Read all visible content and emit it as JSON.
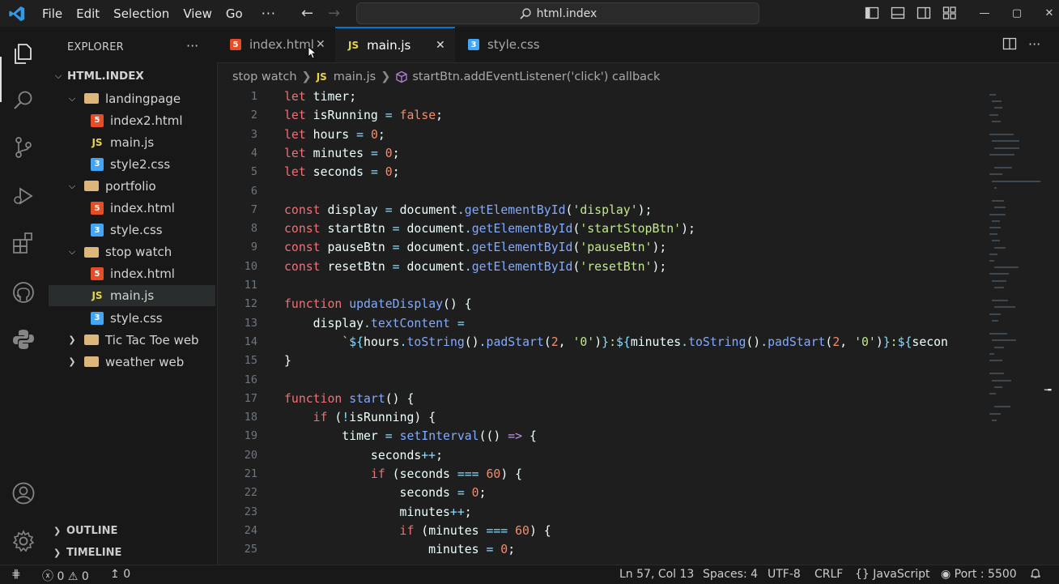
{
  "titlebar": {
    "menu": [
      "File",
      "Edit",
      "Selection",
      "View",
      "Go"
    ],
    "more": "···",
    "search_text": "html.index",
    "window_controls": [
      "—",
      "▢",
      "✕"
    ]
  },
  "sidebar": {
    "header": "EXPLORER",
    "header_more": "···",
    "root": "HTML.INDEX",
    "tree": [
      {
        "label": "landingpage",
        "type": "folder",
        "depth": 1,
        "expanded": true
      },
      {
        "label": "index2.html",
        "type": "html",
        "depth": 2
      },
      {
        "label": "main.js",
        "type": "js",
        "depth": 2
      },
      {
        "label": "style2.css",
        "type": "css",
        "depth": 2
      },
      {
        "label": "portfolio",
        "type": "folder",
        "depth": 1,
        "expanded": true
      },
      {
        "label": "index.html",
        "type": "html",
        "depth": 2
      },
      {
        "label": "style.css",
        "type": "css",
        "depth": 2
      },
      {
        "label": "stop watch",
        "type": "folder",
        "depth": 1,
        "expanded": true
      },
      {
        "label": "index.html",
        "type": "html",
        "depth": 2
      },
      {
        "label": "main.js",
        "type": "js",
        "depth": 2,
        "selected": true
      },
      {
        "label": "style.css",
        "type": "css",
        "depth": 2
      },
      {
        "label": "Tic Tac Toe web",
        "type": "folder",
        "depth": 1,
        "expanded": false
      },
      {
        "label": "weather web",
        "type": "folder",
        "depth": 1,
        "expanded": false
      }
    ],
    "outline": "OUTLINE",
    "timeline": "TIMELINE"
  },
  "tabs": [
    {
      "label": "index.html",
      "type": "html",
      "active": false
    },
    {
      "label": "main.js",
      "type": "js",
      "active": true
    },
    {
      "label": "style.css",
      "type": "css",
      "active": false
    }
  ],
  "breadcrumb": {
    "folder": "stop watch",
    "file": "main.js",
    "symbol": "startBtn.addEventListener('click') callback"
  },
  "editor": {
    "lines": [
      "1",
      "2",
      "3",
      "4",
      "5",
      "6",
      "7",
      "8",
      "9",
      "10",
      "11",
      "12",
      "13",
      "14",
      "15",
      "16",
      "17",
      "18",
      "19",
      "20",
      "21",
      "22",
      "23",
      "24",
      "25"
    ]
  },
  "icons": {
    "js_label": "JS",
    "html_label": "5",
    "css_label": "3"
  },
  "statusbar": {
    "errors": "0",
    "warnings": "0",
    "ports": "0",
    "position": "Ln 57, Col 13",
    "spaces": "Spaces: 4",
    "encoding": "UTF-8",
    "eol": "CRLF",
    "language": "JavaScript",
    "port": "Port : 5500"
  },
  "colors": {
    "accent": "#0078d4",
    "keyword": "#f07178",
    "function": "#82aaff",
    "string": "#c3e88d",
    "number": "#f78c6c"
  }
}
